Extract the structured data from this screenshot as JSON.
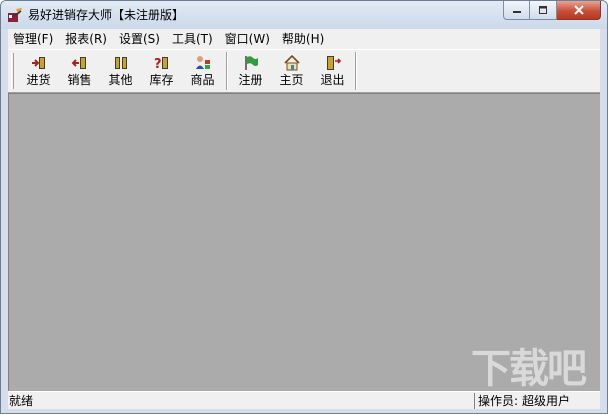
{
  "window": {
    "title": "易好进销存大师【未注册版】",
    "icon": "app-logo-icon",
    "caption_icons": [
      "minimize-icon",
      "maximize-icon",
      "close-icon"
    ]
  },
  "menubar": {
    "items": [
      {
        "label": "管理(F)"
      },
      {
        "label": "报表(R)"
      },
      {
        "label": "设置(S)"
      },
      {
        "label": "工具(T)"
      },
      {
        "label": "窗口(W)"
      },
      {
        "label": "帮助(H)"
      }
    ]
  },
  "toolbar": {
    "buttons": [
      {
        "label": "进货",
        "icon": "stock-in-icon"
      },
      {
        "label": "销售",
        "icon": "sales-icon"
      },
      {
        "label": "其他",
        "icon": "other-icon"
      },
      {
        "label": "库存",
        "icon": "inventory-icon"
      },
      {
        "label": "商品",
        "icon": "goods-icon"
      },
      {
        "label": "注册",
        "icon": "register-flag-icon"
      },
      {
        "label": "主页",
        "icon": "home-icon"
      },
      {
        "label": "退出",
        "icon": "exit-icon"
      }
    ]
  },
  "statusbar": {
    "status": "就绪",
    "operator_label": "操作员:",
    "operator_value": "超级用户"
  },
  "watermark": {
    "text": "下载吧"
  },
  "colors": {
    "client_background": "#ababab",
    "close_button": "#c7503a",
    "chrome": "#f0f0f0"
  }
}
